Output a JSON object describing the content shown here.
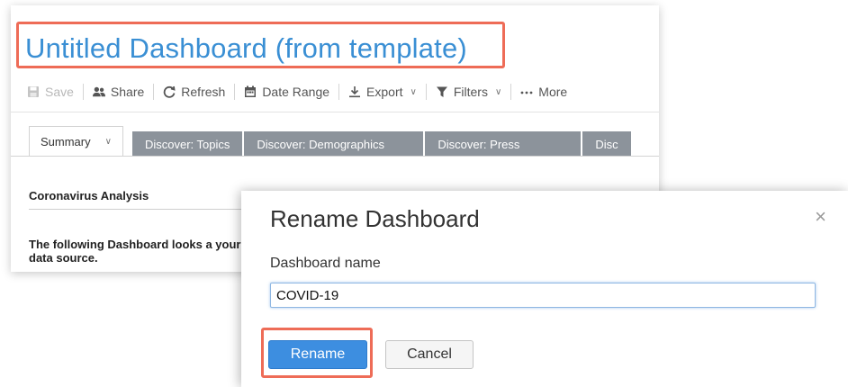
{
  "dashboard": {
    "title": "Untitled Dashboard (from template)",
    "toolbar": {
      "save": "Save",
      "share": "Share",
      "refresh": "Refresh",
      "date_range": "Date Range",
      "export": "Export",
      "filters": "Filters",
      "more": "More"
    },
    "tabs": [
      {
        "label": "Summary"
      },
      {
        "label": "Discover: Topics"
      },
      {
        "label": "Discover: Demographics"
      },
      {
        "label": "Discover: Press"
      },
      {
        "label": "Disc"
      }
    ],
    "section_title": "Coronavirus Analysis",
    "body_text": "The following Dashboard looks a your data source."
  },
  "dialog": {
    "title": "Rename Dashboard",
    "close_symbol": "×",
    "field_label": "Dashboard name",
    "field_value": "COVID-19",
    "rename_label": "Rename",
    "cancel_label": "Cancel"
  },
  "colors": {
    "title_blue": "#3a8fd4",
    "highlight": "#ee6c57",
    "primary_button": "#3d8ee0",
    "tab_gray": "#8c939b"
  },
  "icons": {
    "save": "save-icon",
    "share": "share-icon",
    "refresh": "refresh-icon",
    "date_range": "calendar-icon",
    "export": "download-icon",
    "filters": "filter-icon",
    "more": "ellipsis-icon",
    "close": "close-icon"
  }
}
